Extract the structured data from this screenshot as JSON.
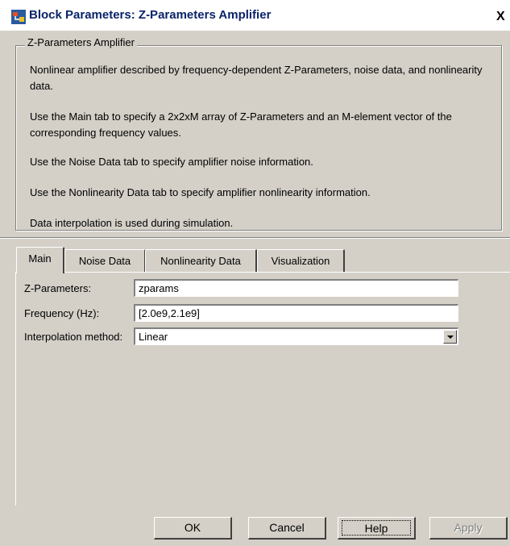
{
  "window": {
    "title": "Block Parameters: Z-Parameters Amplifier",
    "close_label": "X"
  },
  "description": {
    "group_title": "Z-Parameters Amplifier",
    "paragraphs": [
      "Nonlinear amplifier described by frequency-dependent Z-Parameters, noise data, and nonlinearity data.",
      "Use the Main tab to specify a 2x2xM array of Z-Parameters and an M-element vector of the corresponding frequency values.",
      "Use the Noise Data tab to specify amplifier noise information.",
      "Use the Nonlinearity Data tab to specify amplifier nonlinearity information.",
      "Data interpolation is used during simulation."
    ]
  },
  "tabs": [
    {
      "label": "Main",
      "active": true
    },
    {
      "label": "Noise Data",
      "active": false
    },
    {
      "label": "Nonlinearity Data",
      "active": false
    },
    {
      "label": "Visualization",
      "active": false
    }
  ],
  "main": {
    "zparams": {
      "label": "Z-Parameters:",
      "value": "zparams"
    },
    "frequency": {
      "label": "Frequency (Hz):",
      "value": "[2.0e9,2.1e9]"
    },
    "interpolation": {
      "label": "Interpolation method:",
      "value": "Linear"
    }
  },
  "buttons": {
    "ok": "OK",
    "cancel": "Cancel",
    "help": "Help",
    "apply": "Apply"
  },
  "icons": {
    "app": "simulink-block-icon",
    "close": "close-icon",
    "dropdown": "chevron-down-icon"
  }
}
